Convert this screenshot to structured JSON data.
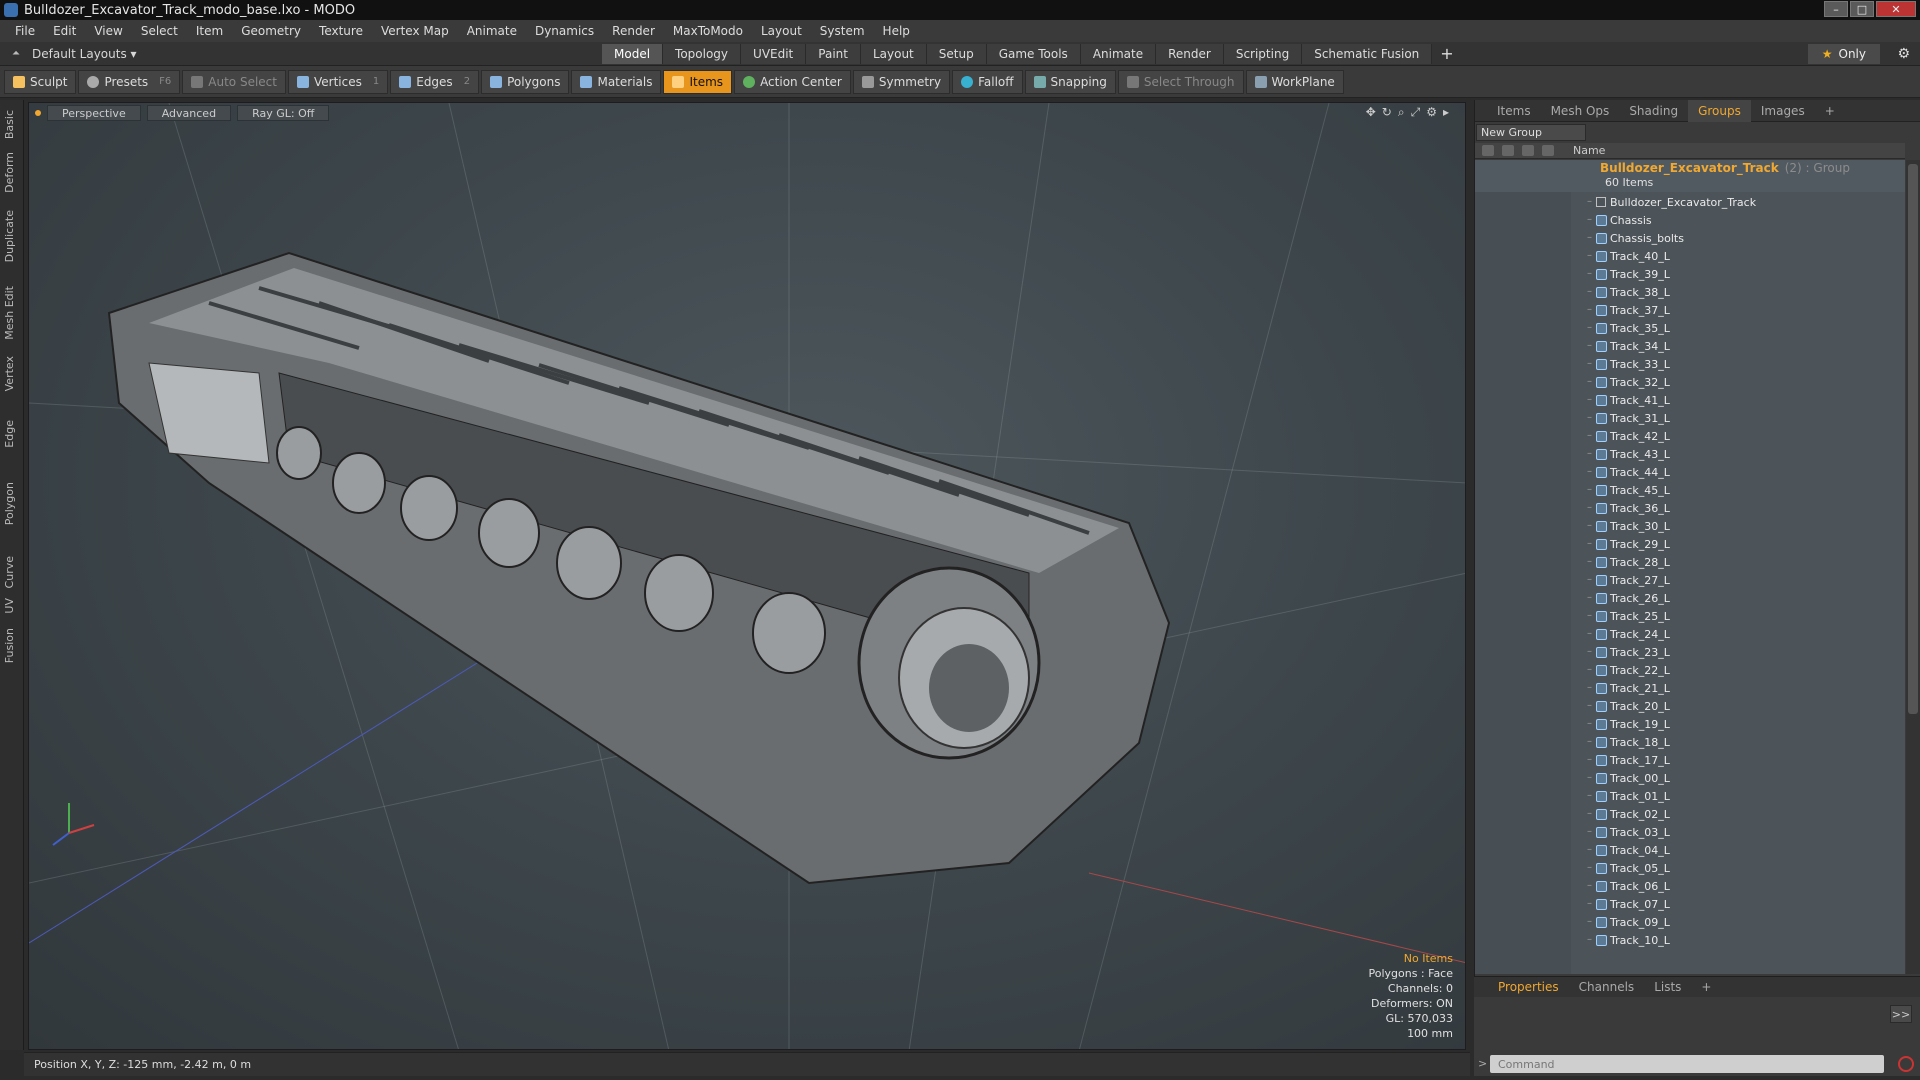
{
  "window": {
    "title": "Bulldozer_Excavator_Track_modo_base.lxo - MODO"
  },
  "menu": [
    "File",
    "Edit",
    "View",
    "Select",
    "Item",
    "Geometry",
    "Texture",
    "Vertex Map",
    "Animate",
    "Dynamics",
    "Render",
    "MaxToModo",
    "Layout",
    "System",
    "Help"
  ],
  "layouts": {
    "label": "Default Layouts ▾"
  },
  "tabs": [
    "Model",
    "Topology",
    "UVEdit",
    "Paint",
    "Layout",
    "Setup",
    "Game Tools",
    "Animate",
    "Render",
    "Scripting",
    "Schematic Fusion"
  ],
  "only_label": "Only",
  "toolbar": {
    "sculpt": "Sculpt",
    "presets": "Presets",
    "presets_key": "F6",
    "auto_select": "Auto Select",
    "vertices": "Vertices",
    "vertices_key": "1",
    "edges": "Edges",
    "edges_key": "2",
    "polygons": "Polygons",
    "materials": "Materials",
    "items": "Items",
    "action_center": "Action Center",
    "symmetry": "Symmetry",
    "falloff": "Falloff",
    "snapping": "Snapping",
    "select_through": "Select Through",
    "workplane": "WorkPlane"
  },
  "left_tabs": [
    "Basic",
    "Deform",
    "Duplicate",
    "Mesh Edit",
    "Vertex",
    "Edge",
    "Polygon",
    "Curve",
    "UV",
    "Fusion"
  ],
  "viewport": {
    "view": "Perspective",
    "shading": "Advanced",
    "raygl": "Ray GL: Off",
    "info": {
      "selection": "No Items",
      "polygons": "Polygons : Face",
      "channels": "Channels: 0",
      "deformers": "Deformers: ON",
      "gl": "GL: 570,033",
      "scale": "100 mm"
    }
  },
  "status": {
    "position": "Position X, Y, Z:  -125 mm, -2.42 m, 0 m"
  },
  "panel": {
    "tabs": [
      "Items",
      "Mesh Ops",
      "Shading",
      "Groups",
      "Images"
    ],
    "new_group": "New Group",
    "name_header": "Name",
    "group": {
      "name": "Bulldozer_Excavator_Track",
      "type": "(2) : Group",
      "count": "60 Items"
    },
    "items": [
      "Bulldozer_Excavator_Track",
      "Chassis",
      "Chassis_bolts",
      "Track_40_L",
      "Track_39_L",
      "Track_38_L",
      "Track_37_L",
      "Track_35_L",
      "Track_34_L",
      "Track_33_L",
      "Track_32_L",
      "Track_41_L",
      "Track_31_L",
      "Track_42_L",
      "Track_43_L",
      "Track_44_L",
      "Track_45_L",
      "Track_36_L",
      "Track_30_L",
      "Track_29_L",
      "Track_28_L",
      "Track_27_L",
      "Track_26_L",
      "Track_25_L",
      "Track_24_L",
      "Track_23_L",
      "Track_22_L",
      "Track_21_L",
      "Track_20_L",
      "Track_19_L",
      "Track_18_L",
      "Track_17_L",
      "Track_00_L",
      "Track_01_L",
      "Track_02_L",
      "Track_03_L",
      "Track_04_L",
      "Track_05_L",
      "Track_06_L",
      "Track_07_L",
      "Track_09_L",
      "Track_10_L"
    ]
  },
  "bottom": {
    "tabs": [
      "Properties",
      "Channels",
      "Lists"
    ],
    "expand": ">>",
    "command_placeholder": "Command"
  }
}
